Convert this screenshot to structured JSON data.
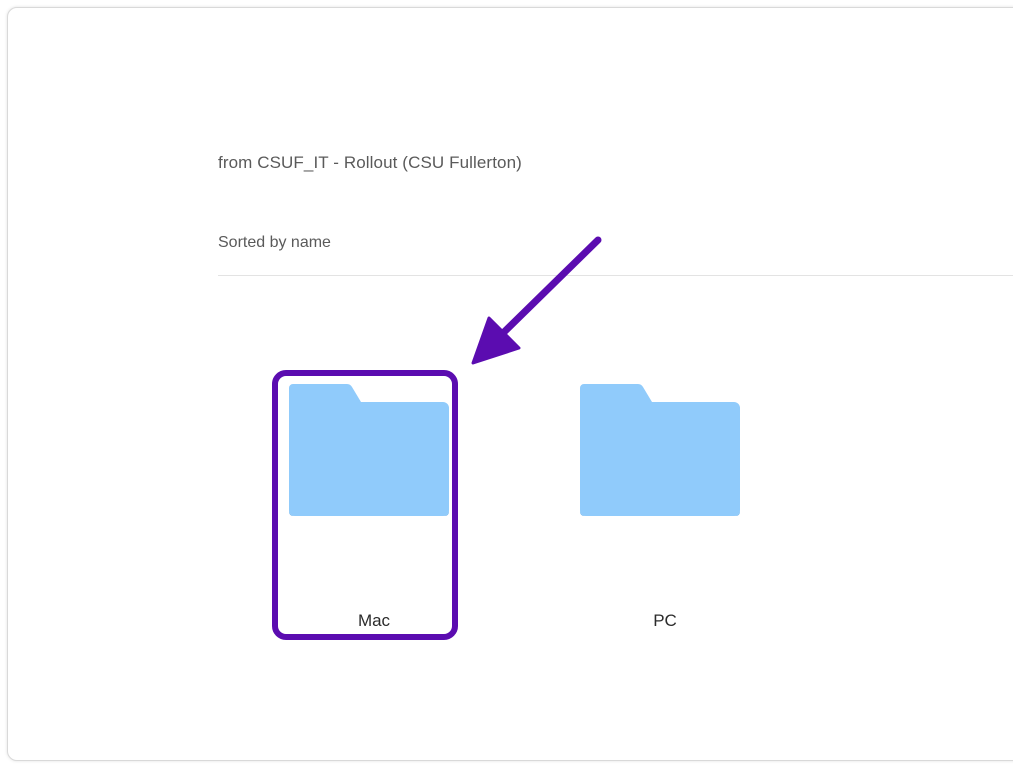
{
  "location": {
    "source_text": "from CSUF_IT - Rollout (CSU Fullerton)"
  },
  "sort": {
    "label": "Sorted by name"
  },
  "folders": [
    {
      "name": "Mac",
      "icon": "folder-icon",
      "color": "#90cbfb",
      "highlighted": true
    },
    {
      "name": "PC",
      "icon": "folder-icon",
      "color": "#90cbfb",
      "highlighted": false
    }
  ],
  "annotation": {
    "icon": "arrow-icon",
    "color": "#5b0cb0"
  }
}
